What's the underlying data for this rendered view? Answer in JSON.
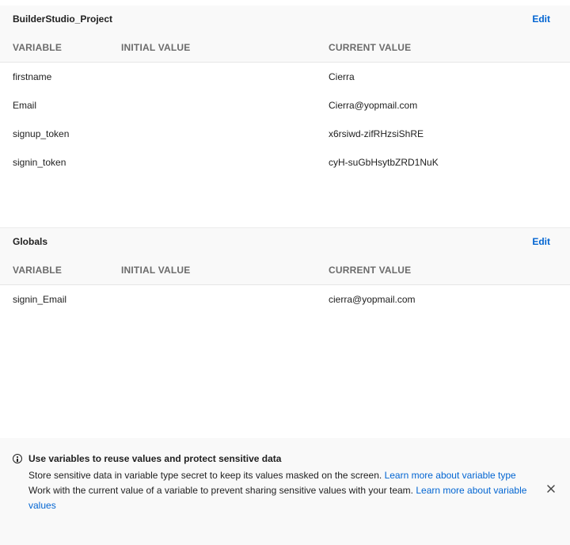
{
  "environment": {
    "title": "BuilderStudio_Project",
    "edit_label": "Edit",
    "columns": [
      "VARIABLE",
      "INITIAL VALUE",
      "CURRENT VALUE"
    ],
    "rows": [
      {
        "variable": "firstname",
        "initial": "",
        "current": "Cierra"
      },
      {
        "variable": "Email",
        "initial": "",
        "current": "Cierra@yopmail.com"
      },
      {
        "variable": "signup_token",
        "initial": "",
        "current": "x6rsiwd-zifRHzsiShRE"
      },
      {
        "variable": "signin_token",
        "initial": "",
        "current": "cyH-suGbHsytbZRD1NuK"
      }
    ]
  },
  "globals": {
    "title": "Globals",
    "edit_label": "Edit",
    "columns": [
      "VARIABLE",
      "INITIAL VALUE",
      "CURRENT VALUE"
    ],
    "rows": [
      {
        "variable": "signin_Email",
        "initial": "",
        "current": "cierra@yopmail.com"
      }
    ]
  },
  "banner": {
    "title": "Use variables to reuse values and protect sensitive data",
    "line1_text": "Store sensitive data in variable type secret to keep its values masked on the screen. ",
    "line1_link": "Learn more about variable type",
    "line2_text": "Work with the current value of a variable to prevent sharing sensitive values with your team. ",
    "line2_link": "Learn more about variable values",
    "icon": "info-icon",
    "close_icon": "close-icon"
  }
}
